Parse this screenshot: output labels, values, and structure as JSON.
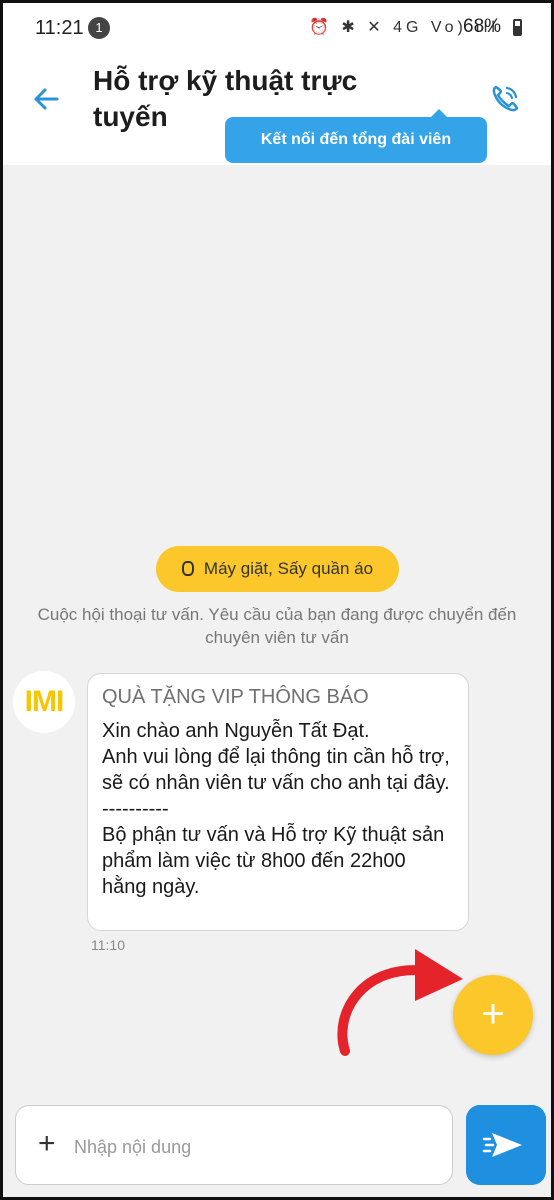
{
  "status_bar": {
    "time": "11:21",
    "notif_count": "1",
    "icons": "⏰ ✱ ✕ 4G Vo) ıll",
    "battery": "68%"
  },
  "header": {
    "title": "Hỗ trợ kỹ thuật trực tuyến",
    "tooltip": "Kết nối đến tổng đài viên"
  },
  "chat": {
    "category": "Máy giặt, Sấy quần áo",
    "system_message": "Cuộc hội thoại tư vấn. Yêu cầu của bạn đang được chuyển đến chuyên viên tư vấn",
    "avatar_text": "IMI",
    "message": {
      "title": "QUÀ TẶNG VIP THÔNG BÁO",
      "body": "Xin chào anh Nguyễn Tất Đạt.\nAnh vui lòng để lại thông tin cần hỗ trợ, sẽ có nhân viên tư vấn cho anh tại đây.\n----------\nBộ phận tư vấn và Hỗ trợ Kỹ thuật sản phẩm làm việc từ 8h00 đến 22h00 hằng ngày.",
      "time": "11:10"
    },
    "fab_symbol": "+"
  },
  "input": {
    "plus_symbol": "+",
    "placeholder": "Nhập nội dung",
    "value": ""
  },
  "colors": {
    "accent_blue": "#34a3e8",
    "send_blue": "#1f8fe0",
    "accent_yellow": "#fcc72a",
    "arrow_red": "#e5232b"
  }
}
